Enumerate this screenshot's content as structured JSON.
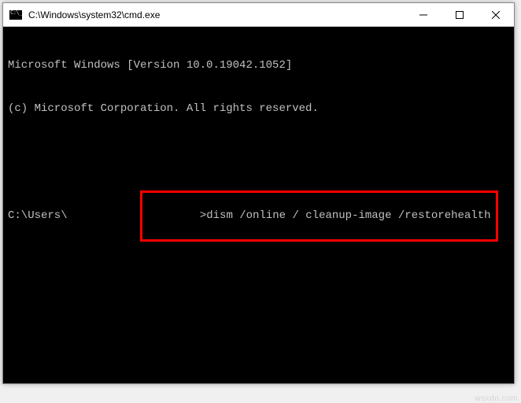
{
  "window": {
    "title": "C:\\Windows\\system32\\cmd.exe"
  },
  "terminal": {
    "line1": "Microsoft Windows [Version 10.0.19042.1052]",
    "line2": "(c) Microsoft Corporation. All rights reserved.",
    "prompt_prefix": "C:\\Users\\",
    "command": ">dism /online / cleanup-image /restorehealth"
  },
  "controls": {
    "minimize": "minimize",
    "maximize": "maximize",
    "close": "close"
  },
  "highlight_color": "#ff0000",
  "watermark": "wsxdn.com"
}
